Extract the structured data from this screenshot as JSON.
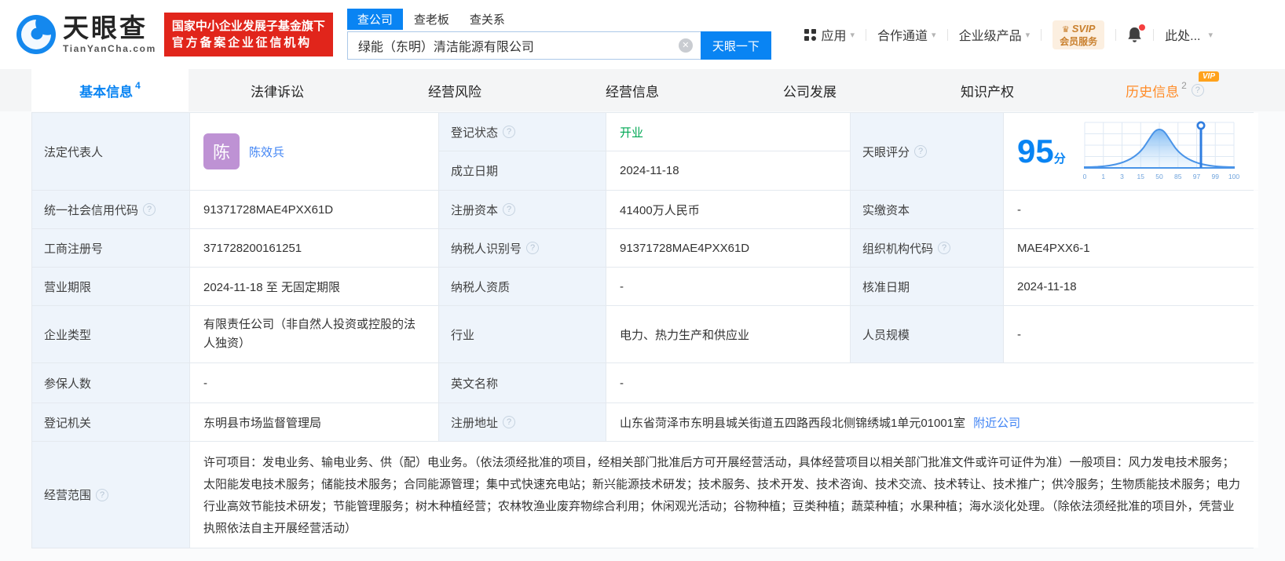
{
  "colors": {
    "primary_blue": "#0984f3",
    "link_blue": "#4285f4",
    "status_green": "#00a854",
    "history_orange": "#ff8b27",
    "badge_red": "#e1251b",
    "avatar_purple": "#be92d4",
    "svip_orange": "#c9802e"
  },
  "header": {
    "brand": {
      "name": "天眼查",
      "domain": "TianYanCha.com"
    },
    "cert_badge": {
      "line1": "国家中小企业发展子基金旗下",
      "line2": "官方备案企业征信机构"
    },
    "search": {
      "tab_company": "查公司",
      "tab_boss": "查老板",
      "tab_relation": "查关系",
      "query": "绿能（东明）清洁能源有限公司",
      "submit": "天眼一下"
    },
    "nav": {
      "apps": "应用",
      "channel": "合作通道",
      "products": "企业级产品",
      "svip_top": "SVIP",
      "svip_bottom": "会员服务",
      "account": "此处..."
    }
  },
  "tabbar": {
    "basic": {
      "label": "基本信息",
      "count": "4"
    },
    "lawsuit": "法律诉讼",
    "risk": "经营风险",
    "operation": "经营信息",
    "development": "公司发展",
    "ip": "知识产权",
    "history": {
      "label": "历史信息",
      "count": "2",
      "vip": "VIP"
    }
  },
  "table": {
    "legal_rep_label": "法定代表人",
    "legal_rep_avatar": "陈",
    "legal_rep_name": "陈效兵",
    "reg_status_label": "登记状态",
    "reg_status_value": "开业",
    "est_date_label": "成立日期",
    "est_date_value": "2024-11-18",
    "score_label": "天眼评分",
    "score_value": "95",
    "score_unit": "分",
    "score_axis": [
      "0",
      "1",
      "3",
      "15",
      "50",
      "85",
      "97",
      "99",
      "100"
    ],
    "uscc_label": "统一社会信用代码",
    "uscc_value": "91371728MAE4PXX61D",
    "reg_capital_label": "注册资本",
    "reg_capital_value": "41400万人民币",
    "paid_capital_label": "实缴资本",
    "paid_capital_value": "-",
    "reg_no_label": "工商注册号",
    "reg_no_value": "371728200161251",
    "taxpayer_id_label": "纳税人识别号",
    "taxpayer_id_value": "91371728MAE4PXX61D",
    "org_code_label": "组织机构代码",
    "org_code_value": "MAE4PXX6-1",
    "biz_term_label": "营业期限",
    "biz_term_value": "2024-11-18 至 无固定期限",
    "taxpayer_qual_label": "纳税人资质",
    "taxpayer_qual_value": "-",
    "approval_date_label": "核准日期",
    "approval_date_value": "2024-11-18",
    "company_type_label": "企业类型",
    "company_type_value": "有限责任公司（非自然人投资或控股的法人独资）",
    "industry_label": "行业",
    "industry_value": "电力、热力生产和供应业",
    "staff_size_label": "人员规模",
    "staff_size_value": "-",
    "insured_label": "参保人数",
    "insured_value": "-",
    "english_name_label": "英文名称",
    "english_name_value": "-",
    "reg_authority_label": "登记机关",
    "reg_authority_value": "东明县市场监督管理局",
    "reg_address_label": "注册地址",
    "reg_address_value": "山东省菏泽市东明县城关街道五四路西段北侧锦绣城1单元01001室",
    "reg_address_link": "附近公司",
    "biz_scope_label": "经营范围",
    "biz_scope_value": "许可项目：发电业务、输电业务、供（配）电业务。（依法须经批准的项目，经相关部门批准后方可开展经营活动，具体经营项目以相关部门批准文件或许可证件为准）一般项目：风力发电技术服务；太阳能发电技术服务；储能技术服务；合同能源管理；集中式快速充电站；新兴能源技术研发；技术服务、技术开发、技术咨询、技术交流、技术转让、技术推广；供冷服务；生物质能技术服务；电力行业高效节能技术研发；节能管理服务；树木种植经营；农林牧渔业废弃物综合利用；休闲观光活动；谷物种植；豆类种植；蔬菜种植；水果种植；海水淡化处理。（除依法须经批准的项目外，凭营业执照依法自主开展经营活动）"
  }
}
